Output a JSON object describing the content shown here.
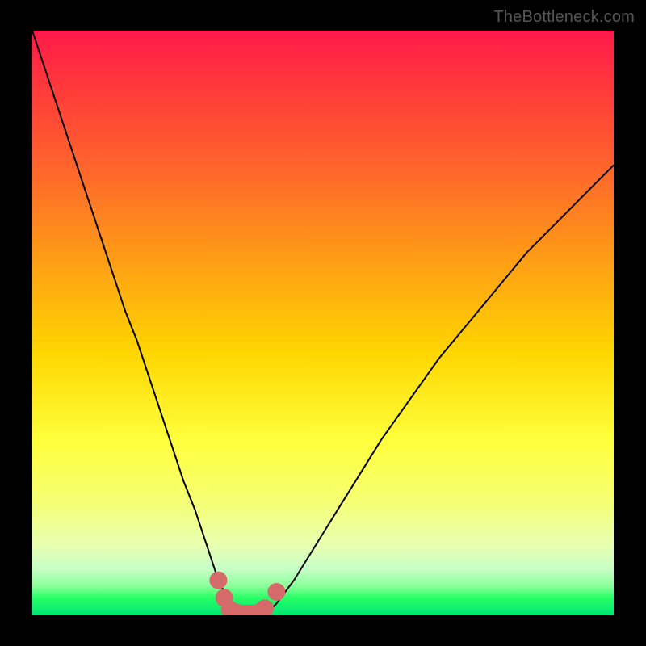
{
  "brand": {
    "label": "TheBottleneck.com"
  },
  "colors": {
    "curve_stroke": "#000000",
    "marker_fill": "#d46a6a",
    "marker_outline": "#c95d5d"
  },
  "chart_data": {
    "type": "line",
    "title": "",
    "xlabel": "",
    "ylabel": "",
    "xlim": [
      0,
      100
    ],
    "ylim": [
      0,
      100
    ],
    "grid": false,
    "series": [
      {
        "name": "bottleneck-curve",
        "x": [
          0,
          2,
          4,
          6,
          8,
          10,
          12,
          14,
          16,
          18,
          20,
          22,
          24,
          26,
          28,
          30,
          32,
          33,
          34,
          35,
          36,
          37,
          38,
          39,
          40,
          41,
          42,
          45,
          50,
          55,
          60,
          65,
          70,
          75,
          80,
          85,
          90,
          95,
          100
        ],
        "y": [
          100,
          94,
          88,
          82,
          76,
          70,
          64,
          58,
          52,
          47,
          41,
          35,
          29,
          23,
          18,
          12,
          6,
          4,
          2,
          1,
          0.5,
          0.2,
          0.2,
          0.2,
          0.4,
          1,
          2,
          6,
          14,
          22,
          30,
          37,
          44,
          50,
          56,
          62,
          67,
          72,
          77
        ]
      }
    ],
    "markers": [
      {
        "x": 32,
        "y": 6
      },
      {
        "x": 33,
        "y": 3
      },
      {
        "x": 34,
        "y": 1
      },
      {
        "x": 35,
        "y": 0.5
      },
      {
        "x": 36,
        "y": 0.3
      },
      {
        "x": 37,
        "y": 0.3
      },
      {
        "x": 38,
        "y": 0.3
      },
      {
        "x": 39,
        "y": 0.5
      },
      {
        "x": 40,
        "y": 1.2
      },
      {
        "x": 42,
        "y": 4
      }
    ],
    "background_gradient": {
      "stops": [
        {
          "pos": 0,
          "color": "#ff1a4a"
        },
        {
          "pos": 10,
          "color": "#ff3a3a"
        },
        {
          "pos": 25,
          "color": "#ff6a2a"
        },
        {
          "pos": 40,
          "color": "#ffa015"
        },
        {
          "pos": 55,
          "color": "#ffd600"
        },
        {
          "pos": 70,
          "color": "#ffff3c"
        },
        {
          "pos": 80,
          "color": "#f6ff70"
        },
        {
          "pos": 88,
          "color": "#e8ffb0"
        },
        {
          "pos": 92,
          "color": "#c8ffc8"
        },
        {
          "pos": 95,
          "color": "#8cff9a"
        },
        {
          "pos": 97,
          "color": "#28ff66"
        },
        {
          "pos": 100,
          "color": "#00e676"
        }
      ]
    }
  }
}
